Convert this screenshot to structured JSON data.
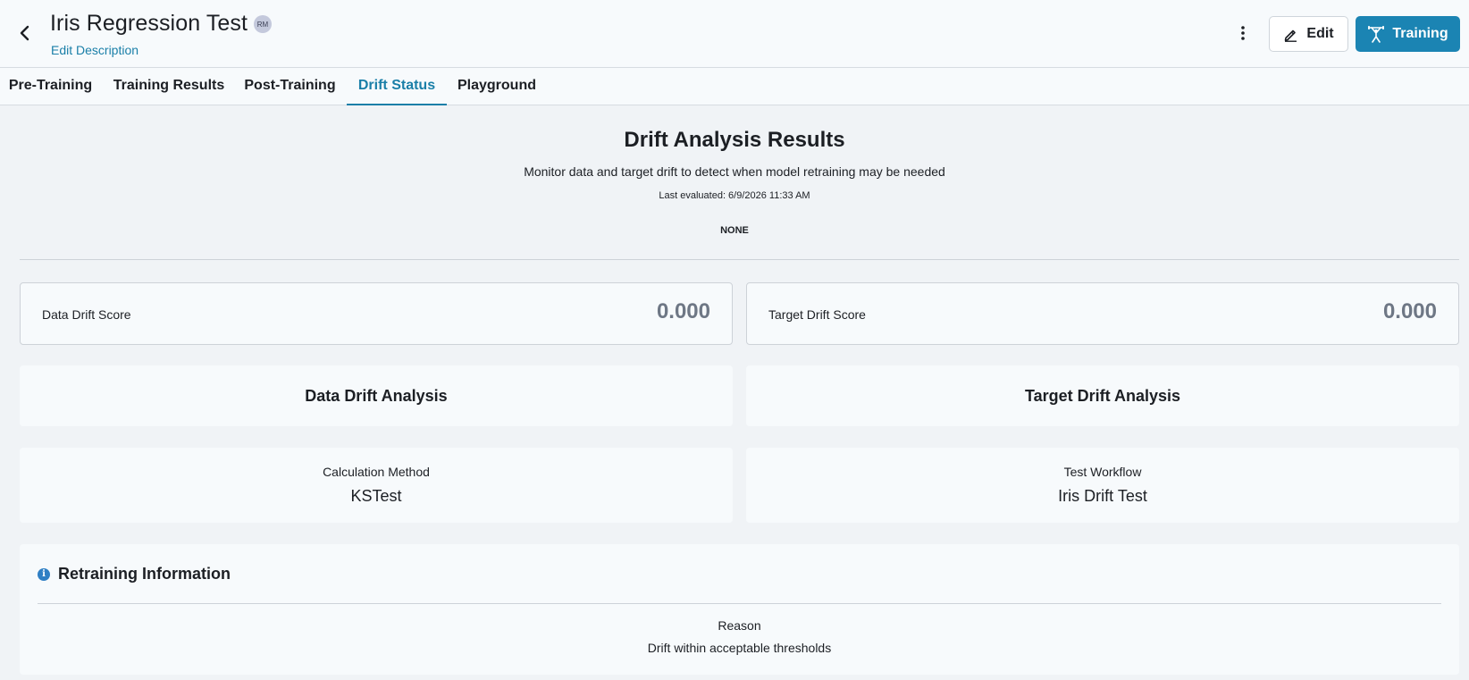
{
  "header": {
    "title": "Iris Regression Test",
    "avatar_initials": "RM",
    "edit_description": "Edit Description",
    "edit_label": "Edit",
    "training_label": "Training",
    "icons": {
      "back": "chevron-left-icon",
      "more": "more-vertical-icon",
      "edit": "pencil-icon",
      "training": "weightlifter-icon"
    }
  },
  "tabs": [
    {
      "label": "Pre-Training",
      "active": false
    },
    {
      "label": "Training Results",
      "active": false
    },
    {
      "label": "Post-Training",
      "active": false
    },
    {
      "label": "Drift Status",
      "active": true
    },
    {
      "label": "Playground",
      "active": false
    }
  ],
  "summary": {
    "title": "Drift Analysis Results",
    "subtitle": "Monitor data and target drift to detect when model retraining may be needed",
    "last_evaluated": "Last evaluated: 6/9/2026 11:33 AM",
    "status": "NONE"
  },
  "scores": {
    "data_label": "Data Drift Score",
    "data_value": "0.000",
    "target_label": "Target Drift Score",
    "target_value": "0.000"
  },
  "analysis": {
    "data_title": "Data Drift Analysis",
    "target_title": "Target Drift Analysis",
    "calc_method_label": "Calculation Method",
    "calc_method_value": "KSTest",
    "test_workflow_label": "Test Workflow",
    "test_workflow_value": "Iris Drift Test"
  },
  "retraining": {
    "title": "Retraining Information",
    "reason_label": "Reason",
    "reason_value": "Drift within acceptable thresholds"
  },
  "colors": {
    "accent": "#1a7fa8",
    "primary_button": "#1b84b3",
    "info_icon": "#2f7fc4",
    "score_value": "#6e7785"
  }
}
